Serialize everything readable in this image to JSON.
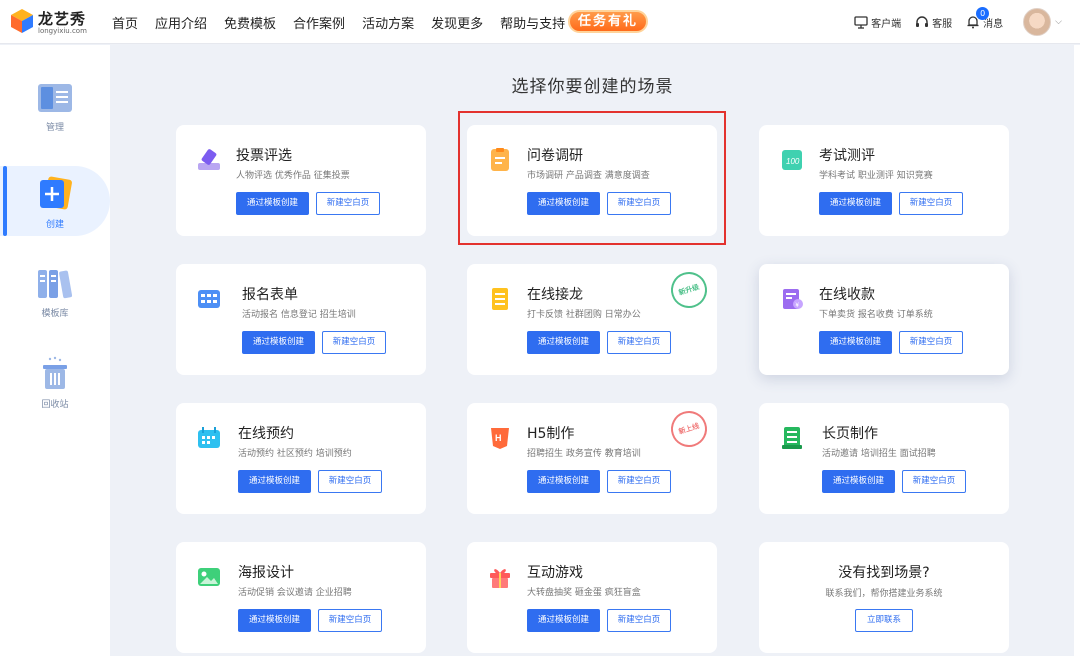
{
  "header": {
    "brand": {
      "name": "龙艺秀",
      "domain": "longyixiu.com"
    },
    "nav": [
      "首页",
      "应用介绍",
      "免费模板",
      "合作案例",
      "活动方案",
      "发现更多",
      "帮助与支持"
    ],
    "cta": "任务有礼",
    "tools": {
      "client": "客户端",
      "service": "客服",
      "messages": "消息",
      "message_count": "0"
    }
  },
  "sidebar": {
    "items": [
      {
        "label": "管理"
      },
      {
        "label": "创建"
      },
      {
        "label": "模板库"
      },
      {
        "label": "回收站"
      }
    ]
  },
  "main": {
    "title": "选择你要创建的场景",
    "btn_template": "通过模板创建",
    "btn_blank": "新建空白页",
    "cards": [
      {
        "title": "投票评选",
        "desc": "人物评选 优秀作品 征集投票"
      },
      {
        "title": "问卷调研",
        "desc": "市场调研 产品调查 满意度调查"
      },
      {
        "title": "考试测评",
        "desc": "学科考试 职业测评 知识竞赛"
      },
      {
        "title": "报名表单",
        "desc": "活动报名 信息登记 招生培训"
      },
      {
        "title": "在线接龙",
        "desc": "打卡反馈 社群团购 日常办公",
        "stamp": "新升级"
      },
      {
        "title": "在线收款",
        "desc": "下单卖货 报名收费 订单系统"
      },
      {
        "title": "在线预约",
        "desc": "活动预约 社区预约 培训预约"
      },
      {
        "title": "H5制作",
        "desc": "招聘招生 政务宣传 教育培训",
        "stamp": "新上线"
      },
      {
        "title": "长页制作",
        "desc": "活动邀请 培训招生 面试招聘"
      },
      {
        "title": "海报设计",
        "desc": "活动促销 会议邀请 企业招聘"
      },
      {
        "title": "互动游戏",
        "desc": "大转盘抽奖 砸金蛋 疯狂盲盒"
      }
    ],
    "no_scene": {
      "title": "没有找到场景?",
      "desc": "联系我们，帮你搭建业务系统",
      "btn": "立即联系"
    }
  }
}
